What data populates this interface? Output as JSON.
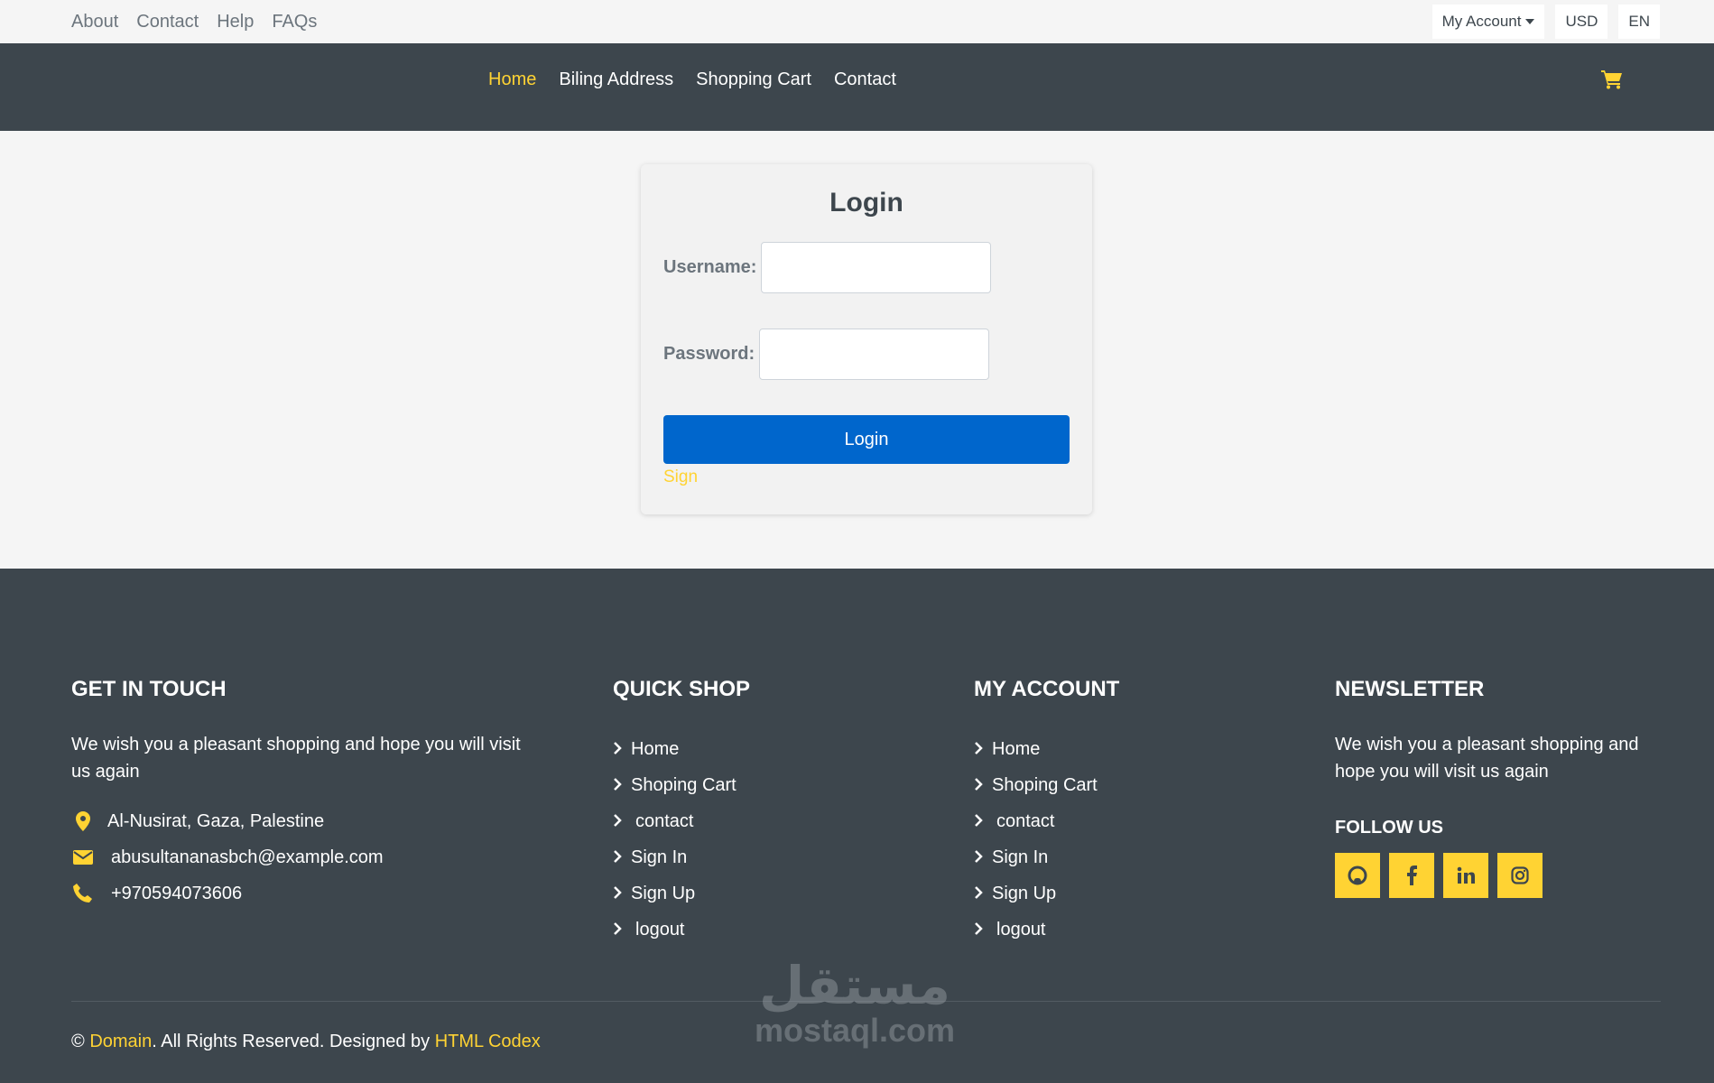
{
  "topbar": {
    "links": [
      "About",
      "Contact",
      "Help",
      "FAQs"
    ],
    "account": "My Account",
    "currency": "USD",
    "language": "EN"
  },
  "nav": {
    "items": [
      "Home",
      "Biling Address",
      "Shopping Cart",
      "Contact"
    ],
    "active": "Home"
  },
  "login": {
    "title": "Login",
    "username_label": "Username:",
    "password_label": "Password:",
    "button": "Login",
    "sign_link": "Sign"
  },
  "footer": {
    "get_in_touch": {
      "title": "GET IN TOUCH",
      "text": "We wish you a pleasant shopping and hope you will visit us again",
      "address": "Al-Nusirat, Gaza, Palestine",
      "email": "abusultananasbch@example.com",
      "phone": "+970594073606"
    },
    "quick_shop": {
      "title": "QUICK SHOP",
      "links": [
        "Home",
        "Shoping Cart",
        "contact",
        "Sign In",
        "Sign Up",
        "logout"
      ]
    },
    "my_account": {
      "title": "MY ACCOUNT",
      "links": [
        "Home",
        "Shoping Cart",
        "contact",
        "Sign In",
        "Sign Up",
        "logout"
      ]
    },
    "newsletter": {
      "title": "NEWSLETTER",
      "text": "We wish you a pleasant shopping and hope you will visit us again",
      "follow": "FOLLOW US",
      "socials": [
        "github-icon",
        "facebook-icon",
        "linkedin-icon",
        "instagram-icon"
      ]
    },
    "copyright": {
      "symbol": "©",
      "domain": "Domain",
      "middle": ". All Rights Reserved. Designed by",
      "designer": "HTML Codex"
    }
  },
  "watermark": {
    "arabic": "مستقل",
    "latin": "mostaql.com"
  },
  "colors": {
    "accent": "#FFD333",
    "dark": "#3D464D",
    "primary_button": "#0066CC"
  }
}
